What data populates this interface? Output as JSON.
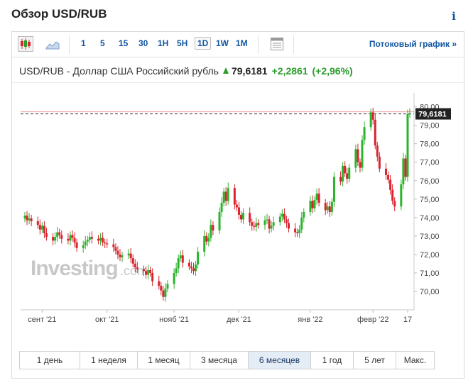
{
  "page": {
    "title": "Обзор USD/RUB",
    "info_label": "i"
  },
  "toolbar": {
    "intervals": [
      "1",
      "5",
      "15",
      "30",
      "1H",
      "5H",
      "1D",
      "1W",
      "1M"
    ],
    "active_interval": "1D",
    "stream_label": "Потоковый график  »"
  },
  "header": {
    "instrument": "USD/RUB - Доллар США Российский рубль",
    "price": "79,6181",
    "change": "+2,2861",
    "change_pct": "(+2,96%)"
  },
  "watermark": {
    "brand": "Investing",
    "suffix": ".com"
  },
  "ranges": {
    "labels": [
      "1 день",
      "1 неделя",
      "1 месяц",
      "3 месяца",
      "6 месяцев",
      "1 год",
      "5 лет",
      "Макс."
    ],
    "active": "6 месяцев"
  },
  "colors": {
    "up": "#2bb32b",
    "down": "#d9232e",
    "link": "#1256a0"
  },
  "chart_data": {
    "type": "candlestick",
    "x_tick_labels": [
      "сент '21",
      "окт '21",
      "нояб '21",
      "дек '21",
      "янв '22",
      "февр '22",
      "17"
    ],
    "y_ticks": [
      "70,00",
      "71,00",
      "72,00",
      "73,00",
      "74,00",
      "75,00",
      "76,00",
      "77,00",
      "78,00",
      "79,00",
      "80,00"
    ],
    "ylim": [
      69.0,
      80.6
    ],
    "last_price": 79.6181,
    "last_price_label": "79,6181",
    "start_date": "2021-08-24",
    "dates": [
      "2021-08-24",
      "2021-08-25",
      "2021-08-26",
      "2021-08-27",
      "2021-08-30",
      "2021-08-31",
      "2021-09-01",
      "2021-09-02",
      "2021-09-03",
      "2021-09-06",
      "2021-09-07",
      "2021-09-08",
      "2021-09-09",
      "2021-09-10",
      "2021-09-13",
      "2021-09-14",
      "2021-09-15",
      "2021-09-16",
      "2021-09-17",
      "2021-09-20",
      "2021-09-21",
      "2021-09-22",
      "2021-09-23",
      "2021-09-24",
      "2021-09-27",
      "2021-09-28",
      "2021-09-29",
      "2021-09-30",
      "2021-10-01",
      "2021-10-04",
      "2021-10-05",
      "2021-10-06",
      "2021-10-07",
      "2021-10-08",
      "2021-10-11",
      "2021-10-12",
      "2021-10-13",
      "2021-10-14",
      "2021-10-15",
      "2021-10-18",
      "2021-10-19",
      "2021-10-20",
      "2021-10-21",
      "2021-10-22",
      "2021-10-25",
      "2021-10-26",
      "2021-10-27",
      "2021-10-28",
      "2021-10-29",
      "2021-11-01",
      "2021-11-02",
      "2021-11-03",
      "2021-11-04",
      "2021-11-05",
      "2021-11-08",
      "2021-11-09",
      "2021-11-10",
      "2021-11-11",
      "2021-11-12",
      "2021-11-15",
      "2021-11-16",
      "2021-11-17",
      "2021-11-18",
      "2021-11-19",
      "2021-11-22",
      "2021-11-23",
      "2021-11-24",
      "2021-11-25",
      "2021-11-26",
      "2021-11-29",
      "2021-11-30",
      "2021-12-01",
      "2021-12-02",
      "2021-12-03",
      "2021-12-06",
      "2021-12-07",
      "2021-12-08",
      "2021-12-09",
      "2021-12-10",
      "2021-12-13",
      "2021-12-14",
      "2021-12-15",
      "2021-12-16",
      "2021-12-17",
      "2021-12-20",
      "2021-12-21",
      "2021-12-22",
      "2021-12-23",
      "2021-12-24",
      "2021-12-27",
      "2021-12-28",
      "2021-12-29",
      "2021-12-30",
      "2021-12-31",
      "2022-01-03",
      "2022-01-04",
      "2022-01-05",
      "2022-01-06",
      "2022-01-07",
      "2022-01-10",
      "2022-01-11",
      "2022-01-12",
      "2022-01-13",
      "2022-01-14",
      "2022-01-17",
      "2022-01-18",
      "2022-01-19",
      "2022-01-20",
      "2022-01-21",
      "2022-01-24",
      "2022-01-25",
      "2022-01-26",
      "2022-01-27",
      "2022-01-28",
      "2022-01-31",
      "2022-02-01",
      "2022-02-02",
      "2022-02-03",
      "2022-02-04",
      "2022-02-07",
      "2022-02-08",
      "2022-02-09",
      "2022-02-10",
      "2022-02-11",
      "2022-02-14",
      "2022-02-15",
      "2022-02-16",
      "2022-02-17",
      "2022-02-18"
    ],
    "closes": [
      74.1,
      73.85,
      73.95,
      73.8,
      73.6,
      73.35,
      73.55,
      73.15,
      72.95,
      72.75,
      72.95,
      73.2,
      73.05,
      72.85,
      72.75,
      73.05,
      72.9,
      72.65,
      72.35,
      72.5,
      72.7,
      72.8,
      72.95,
      72.85,
      72.75,
      72.9,
      72.65,
      72.6,
      72.55,
      72.4,
      72.2,
      72.0,
      71.85,
      71.95,
      72.05,
      71.8,
      71.5,
      71.3,
      71.2,
      71.1,
      70.9,
      71.15,
      71.0,
      70.55,
      70.3,
      70.05,
      69.7,
      70.15,
      70.4,
      71.0,
      71.25,
      71.8,
      71.95,
      71.55,
      71.35,
      71.25,
      71.1,
      71.45,
      72.15,
      73.0,
      72.7,
      72.9,
      73.6,
      73.3,
      74.3,
      74.8,
      75.4,
      74.9,
      75.6,
      74.7,
      74.55,
      74.15,
      73.9,
      74.25,
      73.75,
      73.55,
      73.5,
      73.7,
      73.6,
      73.85,
      73.9,
      73.4,
      73.55,
      73.75,
      74.05,
      74.2,
      73.9,
      73.7,
      73.4,
      73.2,
      73.15,
      73.35,
      74.0,
      74.3,
      74.9,
      74.5,
      74.95,
      75.3,
      74.8,
      74.4,
      74.6,
      74.3,
      74.85,
      76.2,
      75.95,
      76.8,
      76.4,
      76.1,
      76.7,
      77.7,
      77.0,
      76.7,
      78.2,
      78.9,
      79.7,
      79.3,
      77.9,
      77.3,
      76.65,
      76.3,
      76.05,
      75.5,
      74.9,
      74.6,
      75.8,
      77.2,
      76.2,
      79.6,
      79.62
    ],
    "ohlc_note": "Daily candles; closes estimated from chart, opens = previous close"
  }
}
